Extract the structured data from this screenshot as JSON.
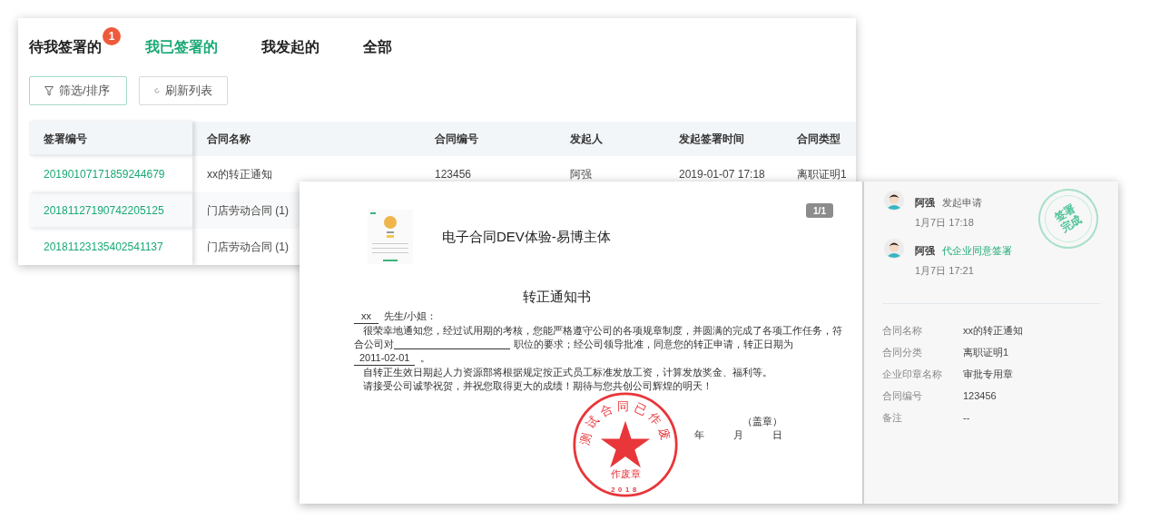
{
  "tabs": [
    {
      "label": "待我签署的",
      "selected": false,
      "badge": "1"
    },
    {
      "label": "我已签署的",
      "selected": true
    },
    {
      "label": "我发起的",
      "selected": false
    },
    {
      "label": "全部",
      "selected": false
    }
  ],
  "toolbar": [
    {
      "kind": "filter",
      "label": "筛选/排序"
    },
    {
      "kind": "refresh",
      "label": "刷新列表"
    }
  ],
  "table": {
    "columns": [
      "签署编号",
      "合同名称",
      "合同编号",
      "发起人",
      "发起签署时间",
      "合同类型"
    ],
    "rows": [
      {
        "cells": [
          "20190107171859244679",
          "xx的转正通知",
          "123456",
          "阿强",
          "2019-01-07 17:18",
          "离职证明1"
        ]
      },
      {
        "cells": [
          "20181127190742205125",
          "门店劳动合同 (1)"
        ]
      },
      {
        "cells": [
          "20181123135402541137",
          "门店劳动合同 (1)"
        ]
      }
    ]
  },
  "document": {
    "page_indicator": "1/1",
    "company": "电子合同DEV体验-易博主体",
    "title": "转正通知书",
    "salutation": {
      "name": "xx",
      "text": "先生/小姐："
    },
    "line_1": "很荣幸地通知您，经过试用期的考核，您能严格遵守公司的各项规章制度，并圆满的完成了各项工作任务，符",
    "line_2": {
      "before": "合公司对",
      "after": "职位的要求；经公司领导批准，同意您的转正申请，转正日期为"
    },
    "line_3": {
      "date": "2011-02-01",
      "after": "。"
    },
    "line_4": "自转正生效日期起人力资源部将根据规定按正式员工标准发放工资，计算发放奖金、福利等。",
    "line_5": "请接受公司诚挚祝贺，并祝您取得更大的成绩！期待与您共创公司辉煌的明天！",
    "seal_note": "（盖章）",
    "date_labels": [
      "年",
      "月",
      "日"
    ],
    "seal": {
      "ring_text": "测试合同已作废",
      "center_text": "作废章",
      "year": "2018"
    }
  },
  "sidebar": {
    "timeline": [
      {
        "name": "阿强",
        "action": "发起申请",
        "time": "1月7日 17:18",
        "kind": "initiate"
      },
      {
        "name": "阿强",
        "action": "代企业同意签署",
        "time": "1月7日 17:21",
        "kind": "sign"
      }
    ],
    "stamp": [
      "签署",
      "完成"
    ],
    "details": [
      {
        "label": "合同名称",
        "value": "xx的转正通知"
      },
      {
        "label": "合同分类",
        "value": "离职证明1"
      },
      {
        "label": "企业印章名称",
        "value": "审批专用章"
      },
      {
        "label": "合同编号",
        "value": "123456"
      },
      {
        "label": "备注",
        "value": "--"
      }
    ]
  }
}
